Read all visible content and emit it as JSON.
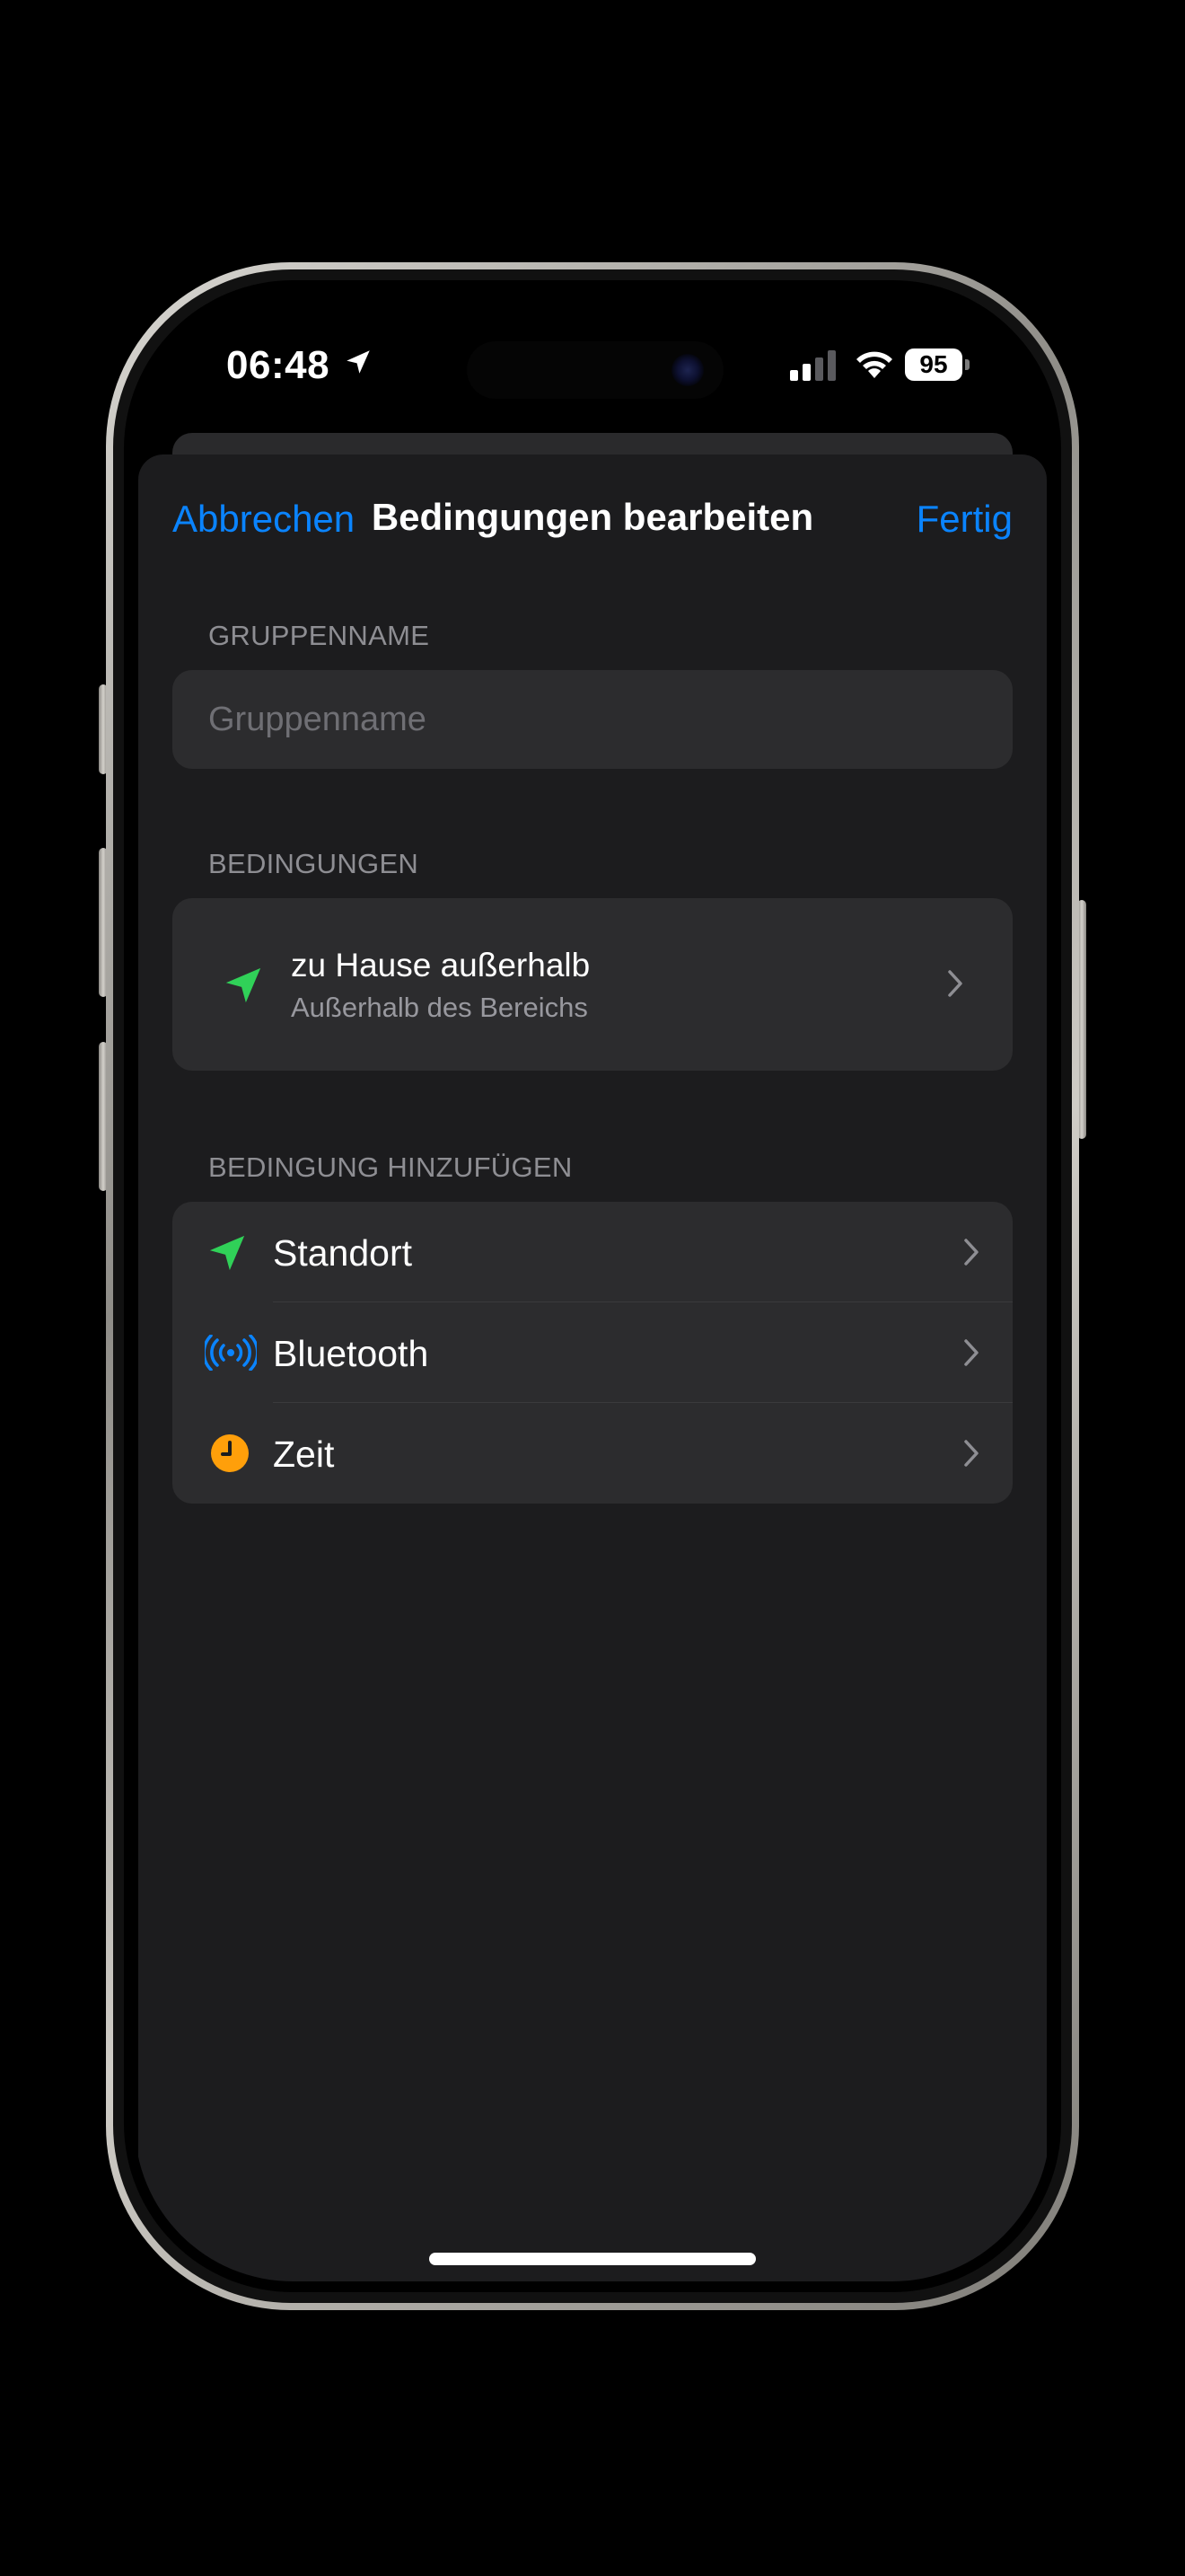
{
  "status_bar": {
    "time": "06:48",
    "battery": "95"
  },
  "nav": {
    "cancel_label": "Abbrechen",
    "title": "Bedingungen bearbeiten",
    "done_label": "Fertig"
  },
  "group_name_section": {
    "header": "GRUPPENNAME",
    "placeholder": "Gruppenname",
    "value": ""
  },
  "conditions_section": {
    "header": "BEDINGUNGEN",
    "items": [
      {
        "title": "zu Hause außerhalb",
        "subtitle": "Außerhalb des Bereichs",
        "icon": "location-arrow-icon"
      }
    ]
  },
  "add_condition_section": {
    "header": "BEDINGUNG HINZUFÜGEN",
    "items": [
      {
        "label": "Standort",
        "icon": "location-arrow-icon"
      },
      {
        "label": "Bluetooth",
        "icon": "bluetooth-broadcast-icon"
      },
      {
        "label": "Zeit",
        "icon": "clock-icon"
      }
    ]
  },
  "colors": {
    "accent_blue": "#0a84ff",
    "location_green": "#30d158",
    "clock_orange": "#ff9f0a",
    "sheet_bg": "#1c1c1e",
    "cell_bg": "#2c2c2e"
  }
}
